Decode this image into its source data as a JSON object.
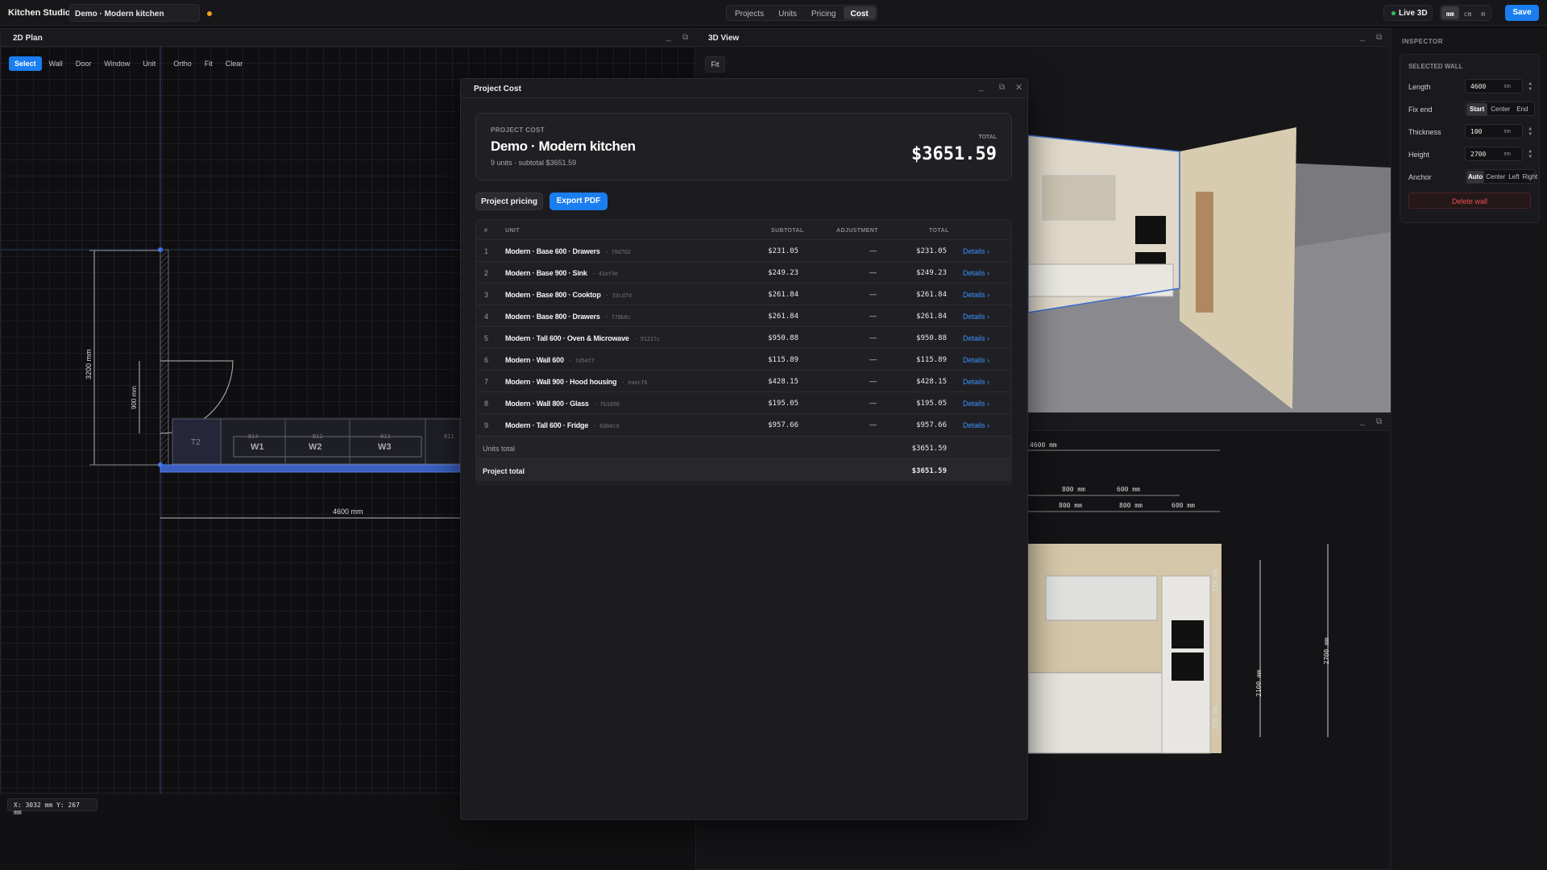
{
  "app": {
    "title": "Kitchen Studio",
    "project_name": "Demo · Modern kitchen"
  },
  "nav": {
    "tabs": [
      "Projects",
      "Units",
      "Pricing",
      "Cost"
    ],
    "active": "Cost"
  },
  "toolbar": {
    "live3d": "Live 3D",
    "units": [
      "mm",
      "cm",
      "m"
    ],
    "save": "Save"
  },
  "plan": {
    "title": "2D Plan",
    "tools": [
      "Select",
      "Wall",
      "Door",
      "Window",
      "Unit",
      "Ortho",
      "Fit",
      "Clear"
    ],
    "active_tool": "Select",
    "dims": {
      "wall_height": "3200 mm",
      "door": "900 mm",
      "width": "4600 mm"
    },
    "unit_labels": {
      "t2": "T2",
      "w1": "W1",
      "w2": "W2",
      "w3": "W3",
      "b14": "B14",
      "b12": "B12",
      "b13": "B13",
      "b11": "B11"
    },
    "coord": "X: 3032 mm   Y: 267 mm"
  },
  "view3d": {
    "title": "3D View",
    "fit": "Fit"
  },
  "elevation": {
    "dims": {
      "top": "4600 mm",
      "a": "800 mm",
      "b": "600 mm",
      "c": "800 mm",
      "d": "800 mm",
      "e": "600 mm",
      "h1": "720 mm",
      "h2": "2100 mm",
      "h3": "2700 mm",
      "h4": "720 mm"
    }
  },
  "inspector": {
    "title": "INSPECTOR",
    "subtitle": "SELECTED WALL",
    "length_label": "Length",
    "length": "4600",
    "unit": "mm",
    "fixend_label": "Fix end",
    "fixend_options": [
      "Start",
      "Center",
      "End"
    ],
    "thickness_label": "Thickness",
    "thickness": "100",
    "height_label": "Height",
    "height": "2700",
    "anchor_label": "Anchor",
    "anchor_options": [
      "Auto",
      "Center",
      "Left",
      "Right"
    ],
    "delete": "Delete wall"
  },
  "cost": {
    "title": "Project Cost",
    "label": "PROJECT COST",
    "name": "Demo · Modern kitchen",
    "meta": "9 units · subtotal $3651.59",
    "total_label": "TOTAL",
    "total": "$3651.59",
    "btn_pricing": "Project pricing",
    "btn_pdf": "Export PDF",
    "headers": {
      "num": "#",
      "unit": "UNIT",
      "subtotal": "SUBTOTAL",
      "adjustment": "ADJUSTMENT",
      "total": "TOTAL"
    },
    "rows": [
      {
        "n": "1",
        "unit": "Modern · Base 600 · Drawers",
        "id": "· 70d702",
        "subtotal": "$231.05",
        "adj": "—",
        "total": "$231.05",
        "details": "Details ›"
      },
      {
        "n": "2",
        "unit": "Modern · Base 900 · Sink",
        "id": "· 41ef9e",
        "subtotal": "$249.23",
        "adj": "—",
        "total": "$249.23",
        "details": "Details ›"
      },
      {
        "n": "3",
        "unit": "Modern · Base 800 · Cooktop",
        "id": "· 33cd7d",
        "subtotal": "$261.84",
        "adj": "—",
        "total": "$261.84",
        "details": "Details ›"
      },
      {
        "n": "4",
        "unit": "Modern · Base 800 · Drawers",
        "id": "· 778b6c",
        "subtotal": "$261.84",
        "adj": "—",
        "total": "$261.84",
        "details": "Details ›"
      },
      {
        "n": "5",
        "unit": "Modern · Tall 600 · Oven & Microwave",
        "id": "· 91217c",
        "subtotal": "$950.88",
        "adj": "—",
        "total": "$950.88",
        "details": "Details ›"
      },
      {
        "n": "6",
        "unit": "Modern · Wall 600",
        "id": "· 7d54ff",
        "subtotal": "$115.89",
        "adj": "—",
        "total": "$115.89",
        "details": "Details ›"
      },
      {
        "n": "7",
        "unit": "Modern · Wall 900 · Hood housing",
        "id": "· eaecf6",
        "subtotal": "$428.15",
        "adj": "—",
        "total": "$428.15",
        "details": "Details ›"
      },
      {
        "n": "8",
        "unit": "Modern · Wall 800 · Glass",
        "id": "· fb1090",
        "subtotal": "$195.05",
        "adj": "—",
        "total": "$195.05",
        "details": "Details ›"
      },
      {
        "n": "9",
        "unit": "Modern · Tall 600 · Fridge",
        "id": "· 6db0cd",
        "subtotal": "$957.66",
        "adj": "—",
        "total": "$957.66",
        "details": "Details ›"
      }
    ],
    "units_total_label": "Units total",
    "units_total": "$3651.59",
    "project_total_label": "Project total",
    "project_total": "$3651.59"
  }
}
